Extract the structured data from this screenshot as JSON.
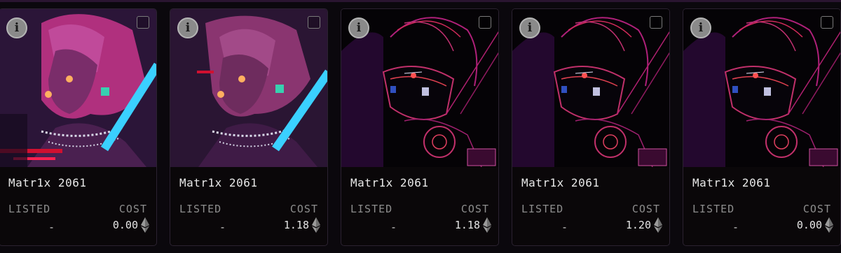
{
  "cards": [
    {
      "name": "Matr1x 2061",
      "listed_label": "LISTED",
      "listed_value": "-",
      "cost_label": "COST",
      "cost_value": "0.00",
      "art": "glitch-neon-character",
      "info_icon": "i"
    },
    {
      "name": "Matr1x 2061",
      "listed_label": "LISTED",
      "listed_value": "-",
      "cost_label": "COST",
      "cost_value": "1.18",
      "art": "glitch-neon-character",
      "info_icon": "i"
    },
    {
      "name": "Matr1x 2061",
      "listed_label": "LISTED",
      "listed_value": "-",
      "cost_label": "COST",
      "cost_value": "1.18",
      "art": "masked-character-outline",
      "info_icon": "i"
    },
    {
      "name": "Matr1x 2061",
      "listed_label": "LISTED",
      "listed_value": "-",
      "cost_label": "COST",
      "cost_value": "1.20",
      "art": "masked-character-outline",
      "info_icon": "i"
    },
    {
      "name": "Matr1x 2061",
      "listed_label": "LISTED",
      "listed_value": "-",
      "cost_label": "COST",
      "cost_value": "0.00",
      "art": "masked-character-outline",
      "info_icon": "i"
    }
  ],
  "colors": {
    "background": "#0b080d",
    "card_border": "#2b2230",
    "accent_pink": "#d0308a",
    "accent_cyan": "#3ad0ff"
  },
  "currency_icon": "ethereum-icon"
}
